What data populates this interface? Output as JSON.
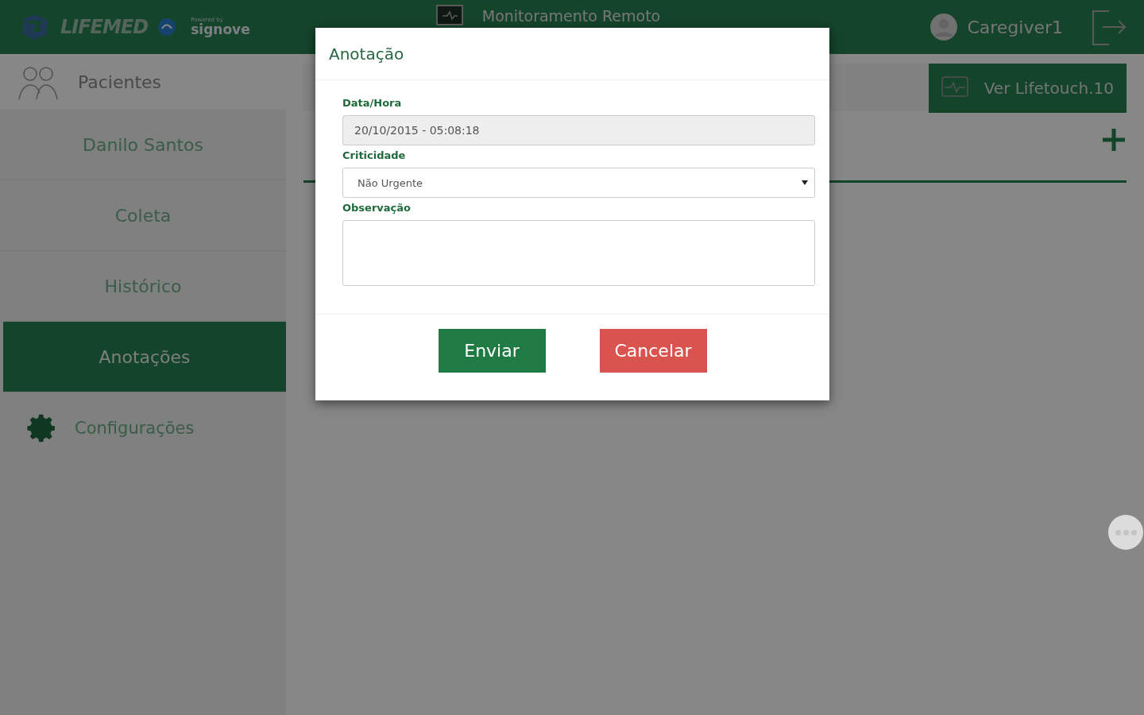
{
  "header": {
    "logo": "LIFEMED",
    "powered_by": "Powered by",
    "partner": "signove",
    "title": "Monitoramento Remoto",
    "user": "Caregiver1"
  },
  "sidebar": {
    "heading": "Pacientes",
    "items": [
      {
        "label": "Danilo Santos",
        "selected": false
      },
      {
        "label": "Coleta",
        "selected": false
      },
      {
        "label": "Histórico",
        "selected": false
      },
      {
        "label": "Anotações",
        "selected": true
      }
    ],
    "settings": "Configurações"
  },
  "toolbar": {
    "button": "Ver Lifetouch.10"
  },
  "modal": {
    "title": "Anotação",
    "fields": [
      {
        "kind": "text",
        "label": "Data/Hora",
        "value": "20/10/2015 - 05:08:18",
        "disabled": true
      },
      {
        "kind": "select",
        "label": "Criticidade",
        "value": "Não Urgente"
      },
      {
        "kind": "textarea",
        "label": "Observação"
      }
    ],
    "buttons": [
      {
        "label": "Enviar",
        "kind": "primary"
      },
      {
        "label": "Cancelar",
        "kind": "danger"
      }
    ]
  }
}
